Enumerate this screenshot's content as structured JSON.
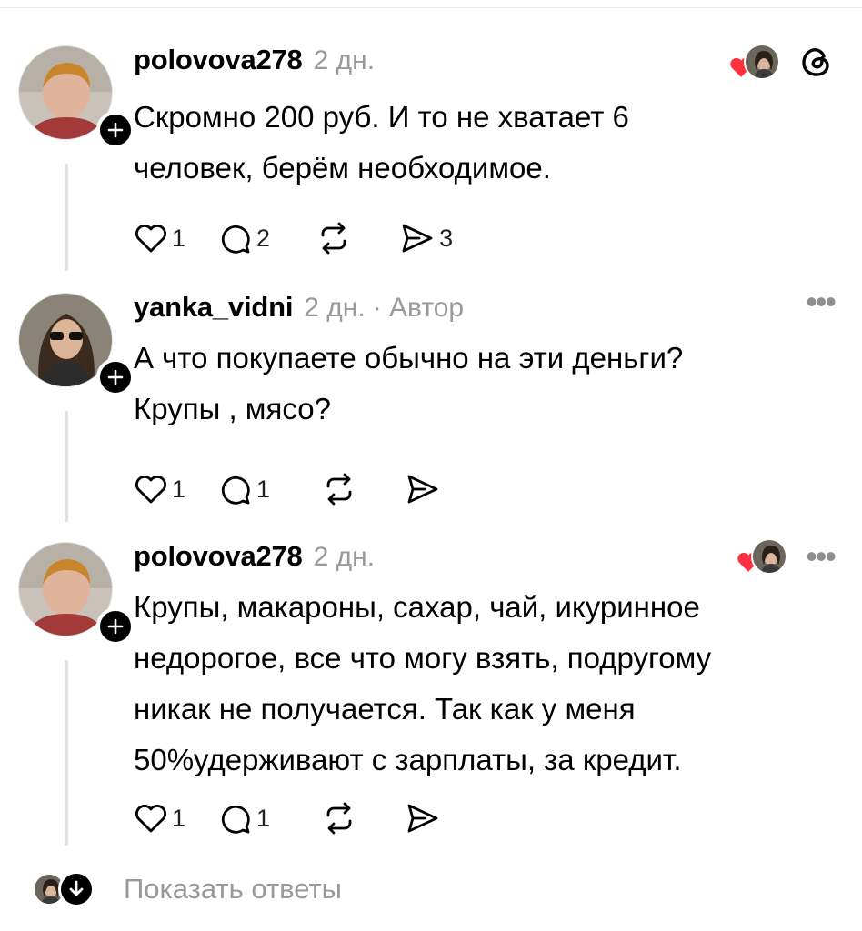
{
  "posts": [
    {
      "username": "polovova278",
      "time": "2 дн.",
      "author_tag": "",
      "text_lines": [
        "Скромно 200 руб. И то не хватает 6",
        "человек, берём необходимое."
      ],
      "likes": "1",
      "replies": "2",
      "reposts": "",
      "shares": "3",
      "liked_by_author": true,
      "right_icon": "threads-logo-icon"
    },
    {
      "username": "yanka_vidni",
      "time": "2 дн.",
      "author_tag": "· Автор",
      "text_lines": [
        "А что покупаете обычно на эти деньги?",
        "Крупы , мясо?"
      ],
      "likes": "1",
      "replies": "1",
      "reposts": "",
      "shares": "",
      "liked_by_author": false,
      "right_icon": "more-icon"
    },
    {
      "username": "polovova278",
      "time": "2 дн.",
      "author_tag": "",
      "text_lines": [
        "Крупы, макароны, сахар, чай, икуринное",
        "недорогое, все что могу взять, подругому",
        "никак не получается. Так как у меня",
        "50%удерживают с зарплаты, за кредит."
      ],
      "likes": "1",
      "replies": "1",
      "reposts": "",
      "shares": "",
      "liked_by_author": true,
      "right_icon": "more-icon"
    }
  ],
  "show_replies_label": "Показать ответы",
  "colors": {
    "heart": "#ff3040",
    "muted": "#9a9a9a",
    "thread_line": "#e0e0e0"
  }
}
